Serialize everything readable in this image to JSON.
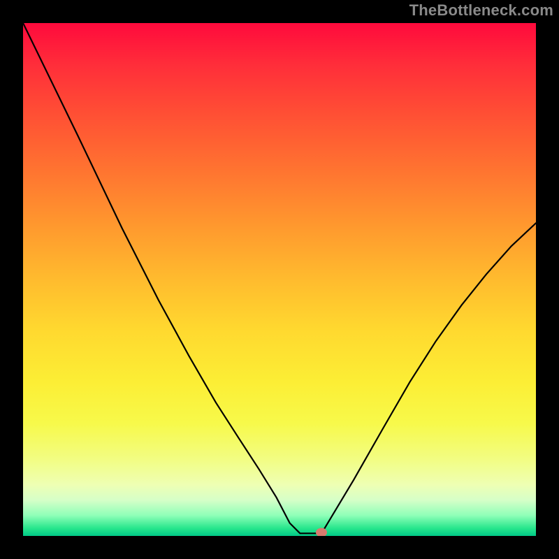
{
  "attribution": "TheBottleneck.com",
  "colors": {
    "background": "#000000",
    "curve": "#000000",
    "marker": "#d77a6e",
    "gradient_top": "#ff0a3c",
    "gradient_bottom": "#00c987"
  },
  "chart_data": {
    "type": "line",
    "title": "",
    "xlabel": "",
    "ylabel": "",
    "xlim": [
      0,
      100
    ],
    "ylim": [
      0,
      100
    ],
    "left_branch": {
      "x": [
        0,
        10.7,
        19.3,
        26.4,
        32.4,
        37.6,
        42.1,
        46.0,
        49.4,
        52,
        54
      ],
      "y": [
        100,
        78,
        60,
        46,
        35,
        26,
        19,
        13,
        7.5,
        2.5,
        0.5
      ]
    },
    "plateau": {
      "x": [
        54,
        58.2
      ],
      "y": [
        0.5,
        0.5
      ]
    },
    "right_branch": {
      "x": [
        58.2,
        64.5,
        70.2,
        75.4,
        80.5,
        85.5,
        90.3,
        95.2,
        100
      ],
      "y": [
        0.5,
        11,
        21,
        30,
        38,
        45,
        51,
        56.5,
        61
      ]
    },
    "marker": {
      "x": 58.2,
      "y": 0.7
    },
    "series_description": "V-shaped bottleneck curve with minimum near x≈54–58. Left branch steeply descends from 100 to 0, brief flat segment at the bottom, right branch rises to ~61."
  }
}
